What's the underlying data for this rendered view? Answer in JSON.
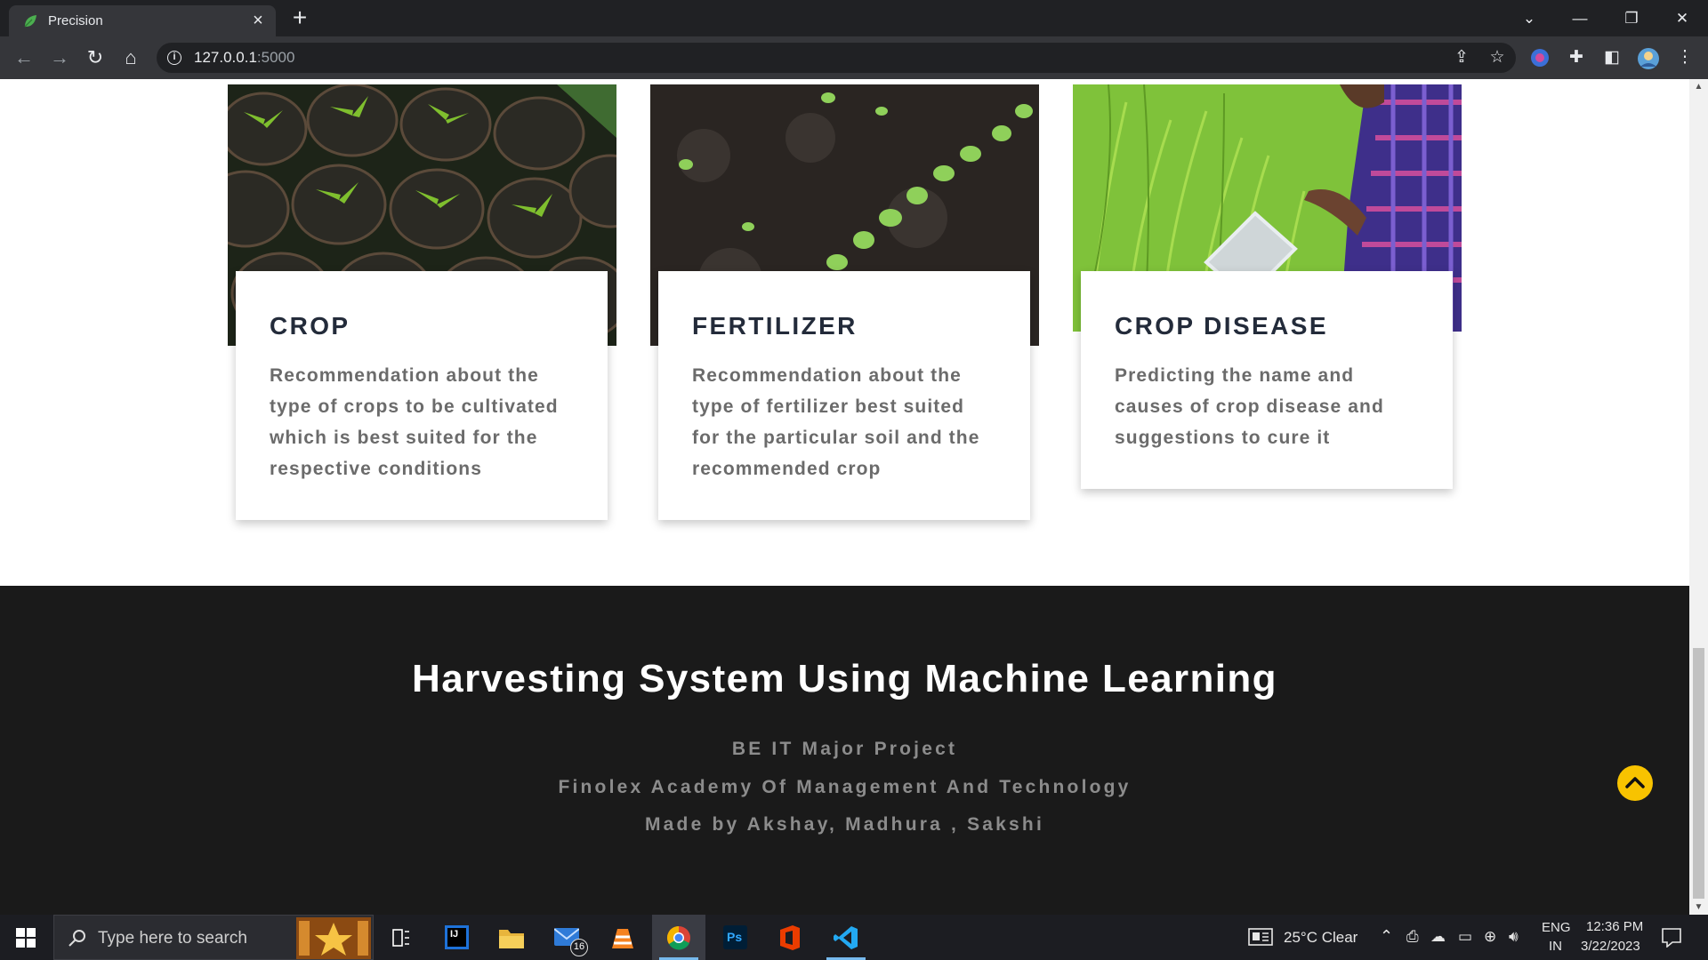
{
  "browser": {
    "tab_title": "Precision",
    "url_host": "127.0.0.1",
    "url_port": ":5000"
  },
  "cards": [
    {
      "title": "CROP",
      "description": "Recommendation about the type of crops to be cultivated which is best suited for the respective conditions"
    },
    {
      "title": "FERTILIZER",
      "description": "Recommendation about the type of fertilizer best suited for the particular soil and the recommended crop"
    },
    {
      "title": "CROP DISEASE",
      "description": "Predicting the name and causes of crop disease and suggestions to cure it"
    }
  ],
  "footer": {
    "title": "Harvesting System Using Machine Learning",
    "line1": "BE IT Major Project",
    "line2": "Finolex Academy Of Management And Technology",
    "line3": "Made by Akshay, Madhura , Sakshi"
  },
  "taskbar": {
    "search_placeholder": "Type here to search",
    "weather": "25°C  Clear",
    "lang": "ENG",
    "region": "IN",
    "time": "12:36 PM",
    "date": "3/22/2023",
    "mail_badge": "16",
    "intellij_label": "IJ",
    "photoshop_label": "Ps"
  },
  "colors": {
    "accent": "#f8c300",
    "footer_bg": "#1a1a1a",
    "card_title": "#232b3a"
  }
}
